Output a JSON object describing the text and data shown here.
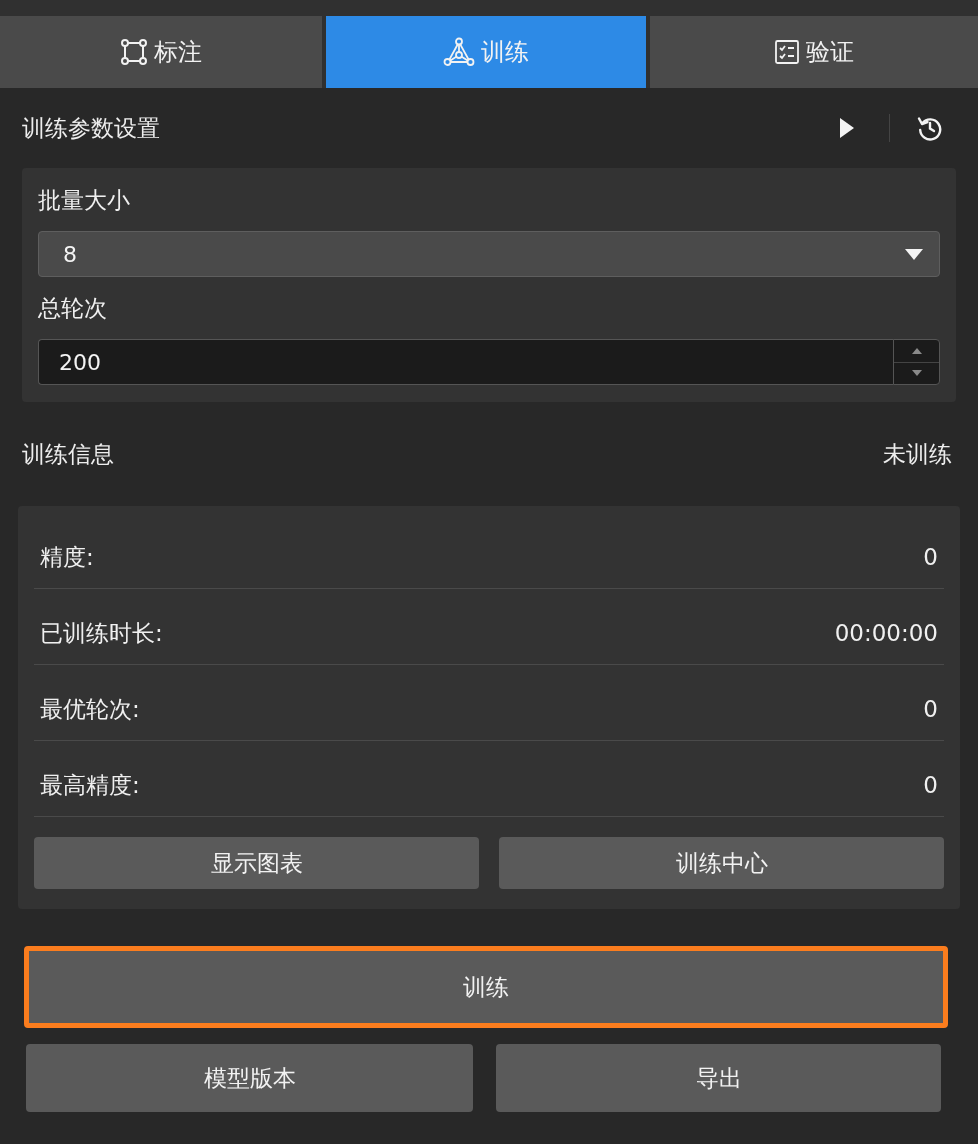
{
  "tabs": [
    {
      "label": "标注",
      "selected": false
    },
    {
      "label": "训练",
      "selected": true
    },
    {
      "label": "验证",
      "selected": false
    }
  ],
  "params": {
    "title": "训练参数设置",
    "fields": [
      {
        "kind": "select",
        "label": "批量大小",
        "value": "8"
      },
      {
        "kind": "number",
        "label": "总轮次",
        "value": "200"
      }
    ]
  },
  "info": {
    "title": "训练信息",
    "status": "未训练",
    "rows": [
      {
        "label": "精度:",
        "value": "0"
      },
      {
        "label": "已训练时长:",
        "value": "00:00:00"
      },
      {
        "label": "最优轮次:",
        "value": "0"
      },
      {
        "label": "最高精度:",
        "value": "0"
      }
    ],
    "buttons": [
      "显示图表",
      "训练中心"
    ]
  },
  "actions": {
    "train": {
      "label": "训练",
      "focused": true
    },
    "buttons": [
      "模型版本",
      "导出"
    ]
  }
}
